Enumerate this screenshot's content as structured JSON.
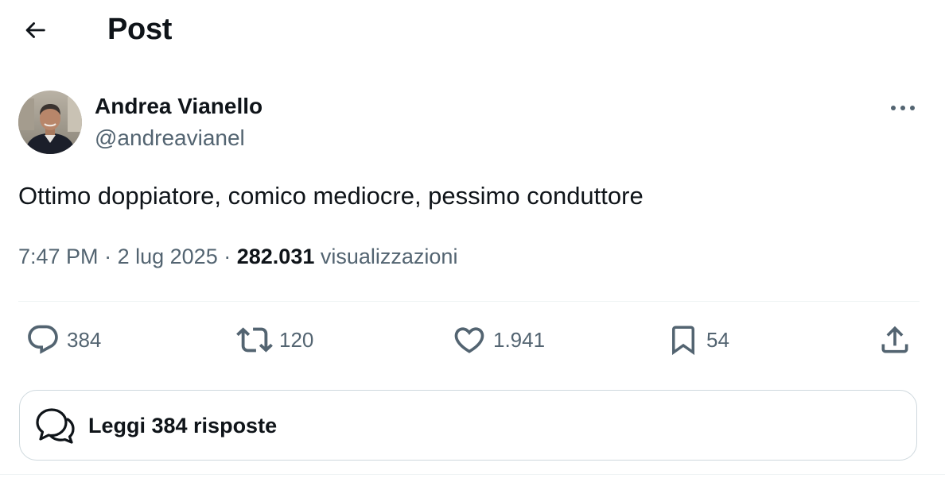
{
  "header": {
    "back_icon": "arrow-left-icon",
    "title": "Post"
  },
  "author": {
    "name": "Andrea Vianello",
    "handle": "@andreavianel",
    "avatar_icon": "profile-photo"
  },
  "post": {
    "text": "Ottimo doppiatore, comico mediocre, pessimo conduttore",
    "time": "7:47 PM",
    "date": "2 lug 2025",
    "separator": "·",
    "views_count": "282.031",
    "views_label": "visualizzazioni"
  },
  "actions": {
    "reply": {
      "icon": "reply-icon",
      "count": "384"
    },
    "repost": {
      "icon": "repost-icon",
      "count": "120"
    },
    "like": {
      "icon": "heart-icon",
      "count": "1.941"
    },
    "bookmark": {
      "icon": "bookmark-icon",
      "count": "54"
    },
    "share": {
      "icon": "share-icon"
    }
  },
  "read_replies": {
    "icon": "conversation-icon",
    "label": "Leggi 384 risposte"
  },
  "colors": {
    "text_primary": "#0f1419",
    "text_secondary": "#536471",
    "border": "#cfd9de",
    "divider": "#eff3f4"
  }
}
